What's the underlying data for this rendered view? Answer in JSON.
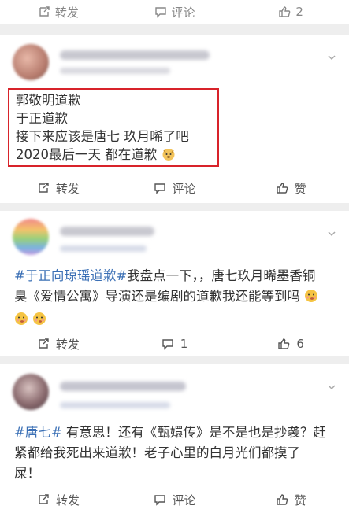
{
  "top_bar": {
    "repost": "转发",
    "comment": "评论",
    "like_count": "2"
  },
  "posts": [
    {
      "lines": [
        "郭敬明道歉",
        "于正道歉",
        "接下来应该是唐七 玖月晞了吧",
        "2020最后一天 都在道歉"
      ],
      "actions": {
        "repost": "转发",
        "comment": "评论",
        "like": "赞"
      }
    },
    {
      "topic": "#于正向琼瑶道歉#",
      "text_line1_rest": "我盘点一下，，唐七玖月晞墨香铜",
      "text_line2": "臭《爱情公寓》导演还是编剧的道歉我还能等到吗",
      "actions": {
        "repost": "转发",
        "comment_count": "1",
        "like_count": "6"
      }
    },
    {
      "topic": "#唐七#",
      "text_line1_rest": " 有意思！还有《甄嬛传》是不是也是抄袭？赶",
      "text_line2": "紧都给我死出来道歉！老子心里的白月光们都摸了",
      "text_line3": "屎！",
      "actions": {
        "repost": "转发",
        "comment": "评论",
        "like": "赞"
      }
    }
  ],
  "colors": {
    "topic": "#3a6fb5",
    "highlight_border": "#d8232a",
    "icon": "#555555"
  }
}
